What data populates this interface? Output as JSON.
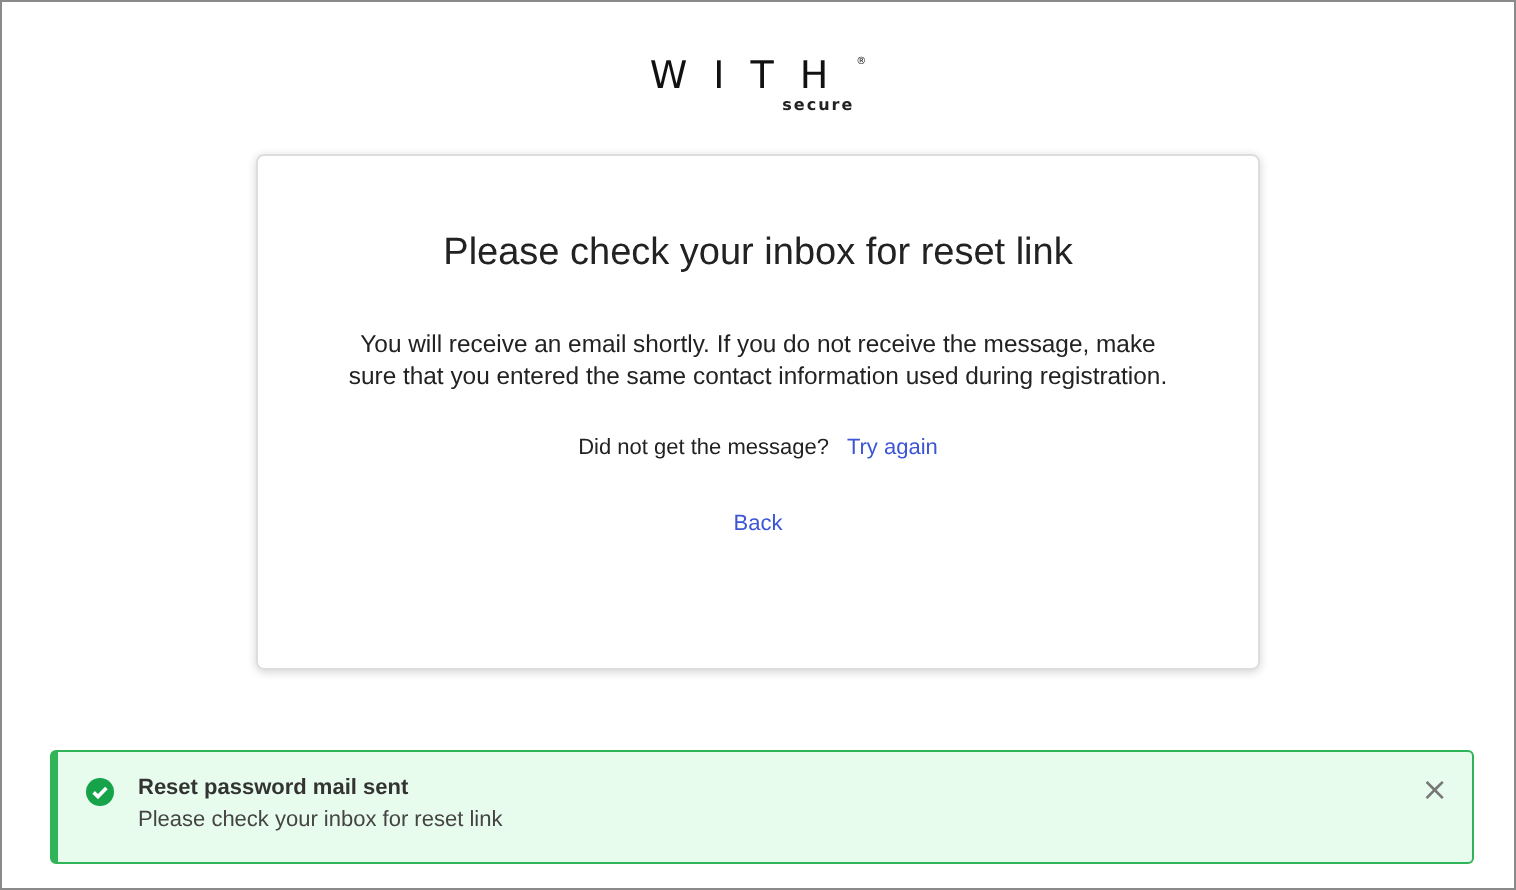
{
  "logo": {
    "wordmark": "WITH",
    "mark": "®",
    "subtitle": "secure"
  },
  "card": {
    "title": "Please check your inbox for reset link",
    "message": "You will receive an email shortly. If you do not receive the message, make sure that you entered the same contact information used during registration.",
    "retry_prompt": "Did not get the message?",
    "retry_link": "Try again",
    "back_link": "Back"
  },
  "toast": {
    "kind": "success",
    "title": "Reset password mail sent",
    "message": "Please check your inbox for reset link",
    "close": "×"
  }
}
